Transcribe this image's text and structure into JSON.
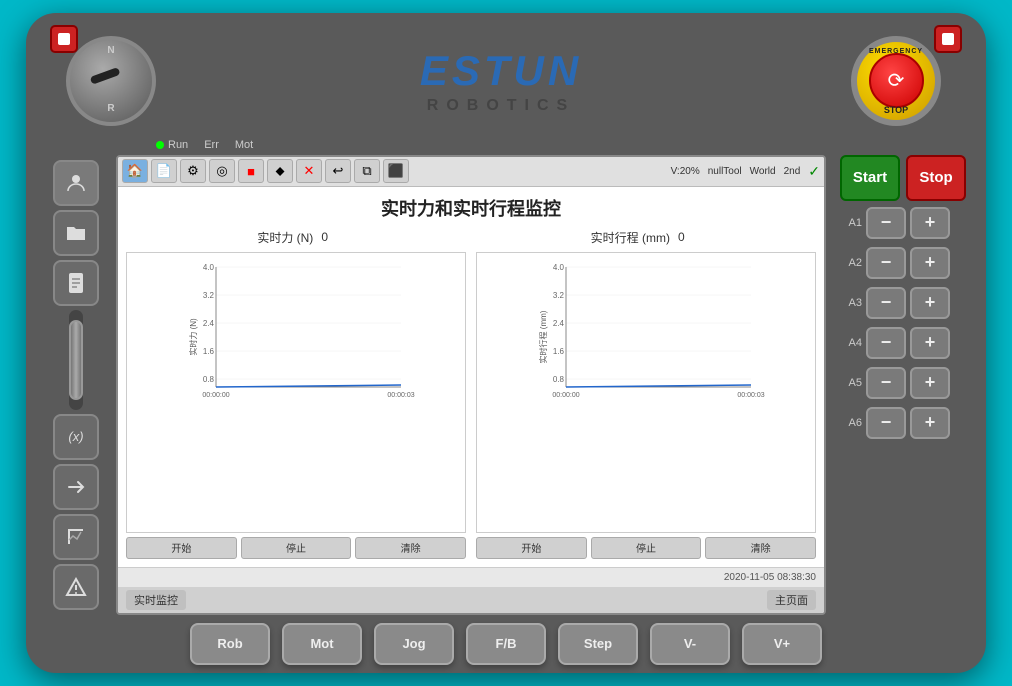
{
  "brand": {
    "name": "ESTUN",
    "sub": "ROBOTICS"
  },
  "status": {
    "run_label": "Run",
    "err_label": "Err",
    "mot_label": "Mot"
  },
  "toolbar": {
    "v_percent": "V:20%",
    "tool_label": "nullTool",
    "coord_label": "World",
    "end_label": "2nd"
  },
  "screen": {
    "title": "实时力和实时行程监控",
    "force_label": "实时力 (N)",
    "force_value": "0",
    "travel_label": "实时行程 (mm)",
    "travel_value": "0",
    "left_chart": {
      "y_label": "实时力 (N)",
      "y_max": "4.0",
      "y_32": "3.2",
      "y_24": "2.4",
      "y_16": "1.6",
      "y_08": "0.8",
      "x_start": "00:00:00",
      "x_end": "00:00:03",
      "btn1": "开始",
      "btn2": "停止",
      "btn3": "清除"
    },
    "right_chart": {
      "y_label": "实时行程 (mm)",
      "y_max": "4.0",
      "y_32": "3.2",
      "y_24": "2.4",
      "y_16": "1.6",
      "y_08": "0.8",
      "x_start": "00:00:00",
      "x_end": "00:00:03",
      "btn1": "开始",
      "btn2": "停止",
      "btn3": "清除"
    },
    "timestamp": "2020-11-05 08:38:30",
    "footer_left": "实时监控",
    "footer_right": "主页面"
  },
  "controls": {
    "start_label": "Start",
    "stop_label": "Stop",
    "axes": [
      {
        "label": "A1",
        "minus": "−",
        "plus": "+"
      },
      {
        "label": "A2",
        "minus": "−",
        "plus": "+"
      },
      {
        "label": "A3",
        "minus": "−",
        "plus": "+"
      },
      {
        "label": "A4",
        "minus": "−",
        "plus": "+"
      },
      {
        "label": "A5",
        "minus": "−",
        "plus": "+"
      },
      {
        "label": "A6",
        "minus": "−",
        "plus": "+"
      }
    ]
  },
  "bottom_buttons": [
    {
      "label": "Rob"
    },
    {
      "label": "Mot"
    },
    {
      "label": "Jog"
    },
    {
      "label": "F/B"
    },
    {
      "label": "Step"
    },
    {
      "label": "V-"
    },
    {
      "label": "V+"
    }
  ],
  "emergency": {
    "text_top": "EMERGENCY",
    "text_bottom": "STOP"
  },
  "sidebar": {
    "items": [
      {
        "icon": "👤",
        "name": "user"
      },
      {
        "icon": "📁",
        "name": "folder"
      },
      {
        "icon": "📄",
        "name": "document"
      },
      {
        "icon": "(x)",
        "name": "variable"
      },
      {
        "icon": "➜",
        "name": "arrow"
      },
      {
        "icon": "📐",
        "name": "coordinate"
      },
      {
        "icon": "⚠",
        "name": "warning"
      }
    ]
  }
}
